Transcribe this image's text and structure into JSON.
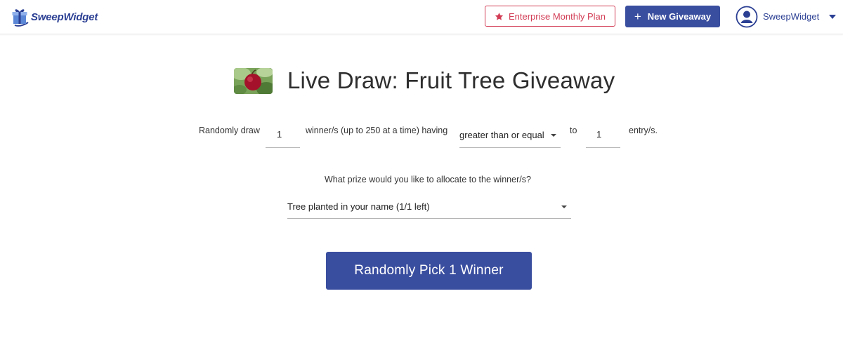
{
  "header": {
    "logo_text": "SweepWidget",
    "plan_button_label": "Enterprise Monthly Plan",
    "new_button_label": "New Giveaway",
    "user_name": "SweepWidget"
  },
  "page": {
    "title": "Live Draw: Fruit Tree Giveaway"
  },
  "draw_form": {
    "prefix_label": "Randomly draw",
    "winners_count": "1",
    "winners_suffix_label": "winner/s (up to 250 at a time) having",
    "comparison_selected": "greater than or equal",
    "to_label": "to",
    "entries_count": "1",
    "entries_suffix_label": "entry/s.",
    "prize_question": "What prize would you like to allocate to the winner/s?",
    "prize_selected": "Tree planted in your name (1/1 left)",
    "pick_button_label": "Randomly Pick 1 Winner"
  },
  "colors": {
    "primary": "#3a4e9f",
    "brand_text": "#2b3f93",
    "plan_accent": "#d23c55"
  },
  "icons": {
    "logo": "gift-box-icon",
    "plan": "star-icon",
    "new": "plus-icon",
    "user": "user-circle-icon",
    "dropdown": "caret-down-icon"
  }
}
